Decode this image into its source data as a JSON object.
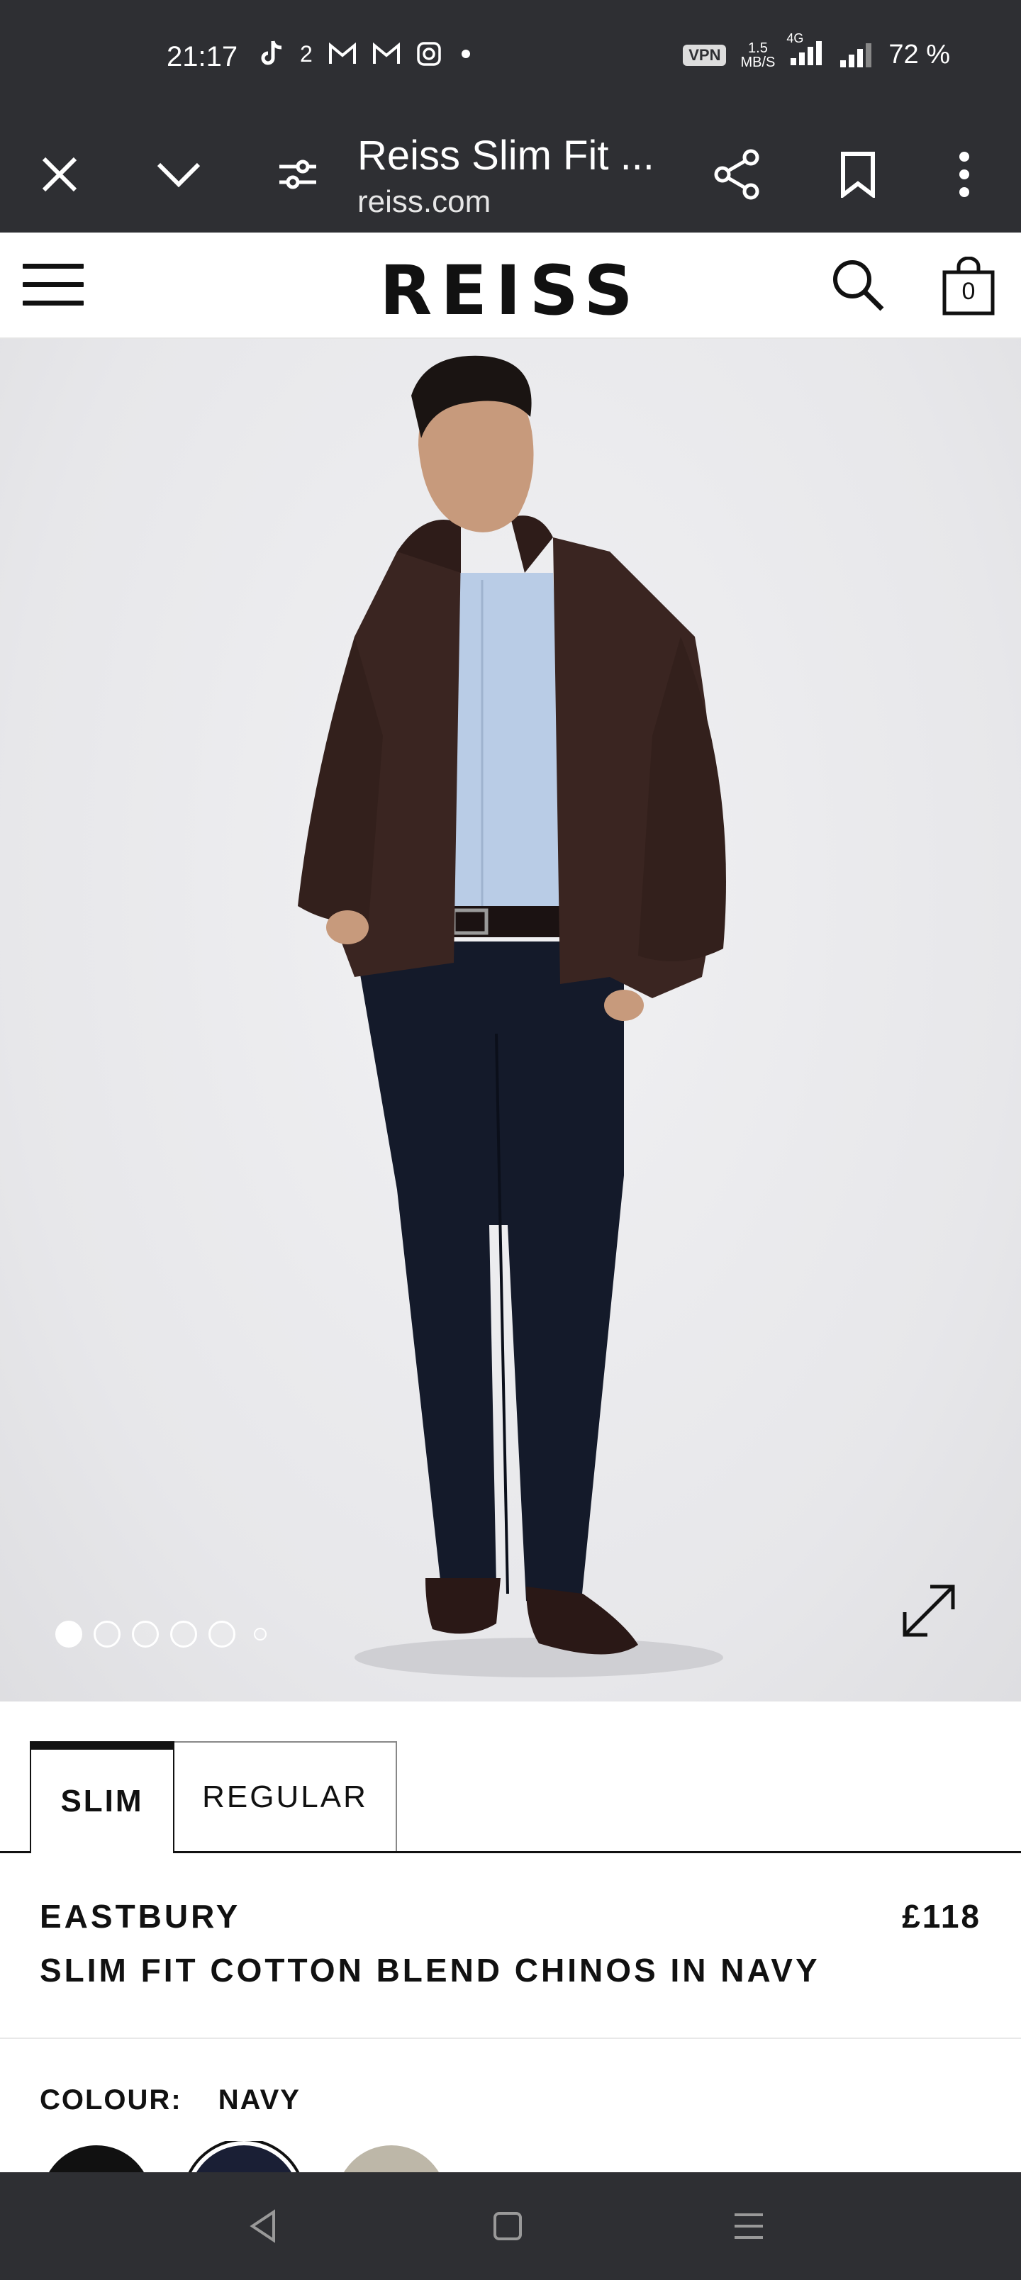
{
  "status_bar": {
    "time": "21:17",
    "notification_count": "2",
    "vpn": "VPN",
    "net_speed_value": "1.5",
    "net_speed_unit": "MB/S",
    "network": "4G",
    "battery": "72 %"
  },
  "browser": {
    "page_title": "Reiss Slim Fit ...",
    "url": "reiss.com"
  },
  "site_header": {
    "logo": "REISS",
    "bag_count": "0"
  },
  "gallery": {
    "image_count": 5,
    "active_index": 0
  },
  "fit_tabs": [
    {
      "label": "SLIM",
      "selected": true
    },
    {
      "label": "REGULAR",
      "selected": false
    }
  ],
  "product": {
    "brand": "EASTBURY",
    "name": "SLIM FIT COTTON BLEND CHINOS IN NAVY",
    "price": "£118"
  },
  "colour": {
    "label": "COLOUR:",
    "value": "NAVY",
    "swatches": [
      "#111111",
      "#1a1f35",
      "#bdb7a8"
    ]
  },
  "colors": {
    "system_bar": "#2e2f33",
    "text": "#111111"
  }
}
